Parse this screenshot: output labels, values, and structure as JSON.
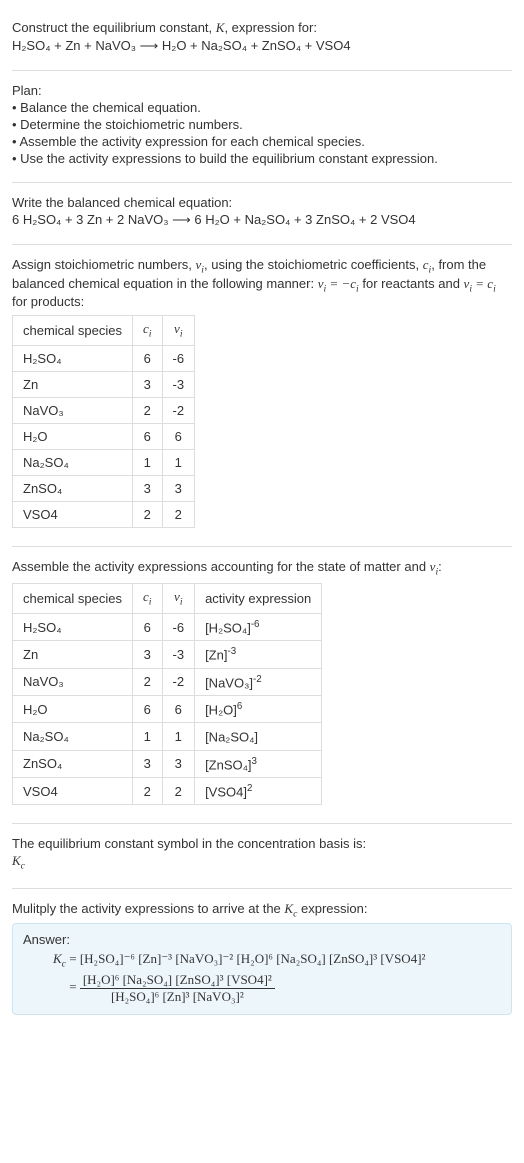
{
  "intro": {
    "line1_a": "Construct the equilibrium constant, ",
    "line1_b": ", expression for:",
    "reaction": "H₂SO₄ + Zn + NaVO₃  ⟶  H₂O + Na₂SO₄ + ZnSO₄ + VSO4"
  },
  "plan": {
    "title": "Plan:",
    "items": [
      "• Balance the chemical equation.",
      "• Determine the stoichiometric numbers.",
      "• Assemble the activity expression for each chemical species.",
      "• Use the activity expressions to build the equilibrium constant expression."
    ]
  },
  "balanced": {
    "title": "Write the balanced chemical equation:",
    "reaction": "6 H₂SO₄ + 3 Zn + 2 NaVO₃  ⟶  6 H₂O + Na₂SO₄ + 3 ZnSO₄ + 2 VSO4"
  },
  "assign": {
    "text_a": "Assign stoichiometric numbers, ",
    "text_b": ", using the stoichiometric coefficients, ",
    "text_c": ", from the balanced chemical equation in the following manner: ",
    "text_d": " for reactants and ",
    "text_e": " for products:"
  },
  "table1": {
    "headers": [
      "chemical species",
      "cᵢ",
      "νᵢ"
    ],
    "rows": [
      [
        "H₂SO₄",
        "6",
        "-6"
      ],
      [
        "Zn",
        "3",
        "-3"
      ],
      [
        "NaVO₃",
        "2",
        "-2"
      ],
      [
        "H₂O",
        "6",
        "6"
      ],
      [
        "Na₂SO₄",
        "1",
        "1"
      ],
      [
        "ZnSO₄",
        "3",
        "3"
      ],
      [
        "VSO4",
        "2",
        "2"
      ]
    ]
  },
  "assemble": {
    "text_a": "Assemble the activity expressions accounting for the state of matter and ",
    "text_b": ":"
  },
  "table2": {
    "headers": [
      "chemical species",
      "cᵢ",
      "νᵢ",
      "activity expression"
    ],
    "rows": [
      {
        "sp": "H₂SO₄",
        "c": "6",
        "v": "-6",
        "a": "[H₂SO₄]",
        "exp": "-6"
      },
      {
        "sp": "Zn",
        "c": "3",
        "v": "-3",
        "a": "[Zn]",
        "exp": "-3"
      },
      {
        "sp": "NaVO₃",
        "c": "2",
        "v": "-2",
        "a": "[NaVO₃]",
        "exp": "-2"
      },
      {
        "sp": "H₂O",
        "c": "6",
        "v": "6",
        "a": "[H₂O]",
        "exp": "6"
      },
      {
        "sp": "Na₂SO₄",
        "c": "1",
        "v": "1",
        "a": "[Na₂SO₄]",
        "exp": ""
      },
      {
        "sp": "ZnSO₄",
        "c": "3",
        "v": "3",
        "a": "[ZnSO₄]",
        "exp": "3"
      },
      {
        "sp": "VSO4",
        "c": "2",
        "v": "2",
        "a": "[VSO4]",
        "exp": "2"
      }
    ]
  },
  "symbol_line": "The equilibrium constant symbol in the concentration basis is:",
  "multiply_line_a": "Mulitply the activity expressions to arrive at the ",
  "multiply_line_b": " expression:",
  "answer": {
    "label": "Answer:",
    "num": "[H₂O]⁶ [Na₂SO₄] [ZnSO₄]³ [VSO4]²",
    "den": "[H₂SO₄]⁶ [Zn]³ [NaVO₃]²",
    "flat": "[H₂SO₄]⁻⁶ [Zn]⁻³ [NaVO₃]⁻² [H₂O]⁶ [Na₂SO₄] [ZnSO₄]³ [VSO4]²"
  }
}
